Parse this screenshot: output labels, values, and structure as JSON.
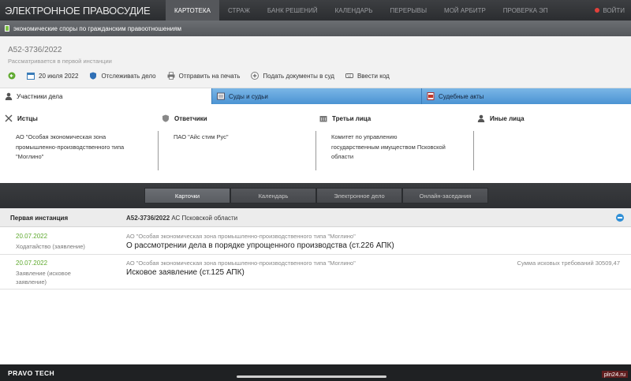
{
  "brand": "ЭЛЕКТРОННОЕ ПРАВОСУДИЕ",
  "nav": [
    "КАРТОТЕКА",
    "СТРАЖ",
    "БАНК РЕШЕНИЙ",
    "КАЛЕНДАРЬ",
    "ПЕРЕРЫВЫ",
    "МОЙ АРБИТР",
    "ПРОВЕРКА ЭП"
  ],
  "exit_label": "ВОЙТИ",
  "category": "экономические споры по гражданским правоотношениям",
  "case": {
    "number": "А52-3736/2022",
    "status": "Рассматривается в первой инстанции"
  },
  "actions": {
    "date": "20 июля 2022",
    "track": "Отслеживать дело",
    "print": "Отправить на печать",
    "submit": "Подать документы в суд",
    "code": "Ввести код"
  },
  "tabs": [
    "Участники дела",
    "Суды и судьи",
    "Судебные акты"
  ],
  "parties": [
    {
      "title": "Истцы",
      "lines": [
        "АО \"Особая экономическая зона",
        "промышленно-производственного типа",
        "\"Моглино\""
      ]
    },
    {
      "title": "Ответчики",
      "lines": [
        "ПАО \"Айс стим Рус\""
      ]
    },
    {
      "title": "Третьи лица",
      "lines": [
        "Комитет по управлению",
        "государственным имуществом Псковской",
        "области"
      ]
    },
    {
      "title": "Иные лица",
      "lines": []
    }
  ],
  "subtabs": [
    "Карточки",
    "Календарь",
    "Электронное дело",
    "Онлайн-заседания"
  ],
  "instance": {
    "label": "Первая инстанция",
    "case_ref": "А52-3736/2022",
    "court": "АС Псковской области"
  },
  "entries": [
    {
      "date": "20.07.2022",
      "kind": [
        "Ходатайство (заявление)"
      ],
      "org": "АО \"Особая экономическая зона промышленно-производственного типа \"Моглино\"",
      "title": "О рассмотрении дела в порядке упрощенного производства (ст.226 АПК)",
      "sum": ""
    },
    {
      "date": "20.07.2022",
      "kind": [
        "Заявление (исковое",
        "заявление)"
      ],
      "org": "АО \"Особая экономическая зона промышленно-производственного типа \"Моглино\"",
      "title": "Исковое заявление (ст.125 АПК)",
      "sum": "Сумма исковых требований 30509,47"
    }
  ],
  "footer": "PRAVO TECH",
  "watermark": "pln24.ru",
  "colors": {
    "accent_blue": "#4b93d3",
    "date_green": "#5faa2f",
    "exit_red": "#e2413b"
  }
}
